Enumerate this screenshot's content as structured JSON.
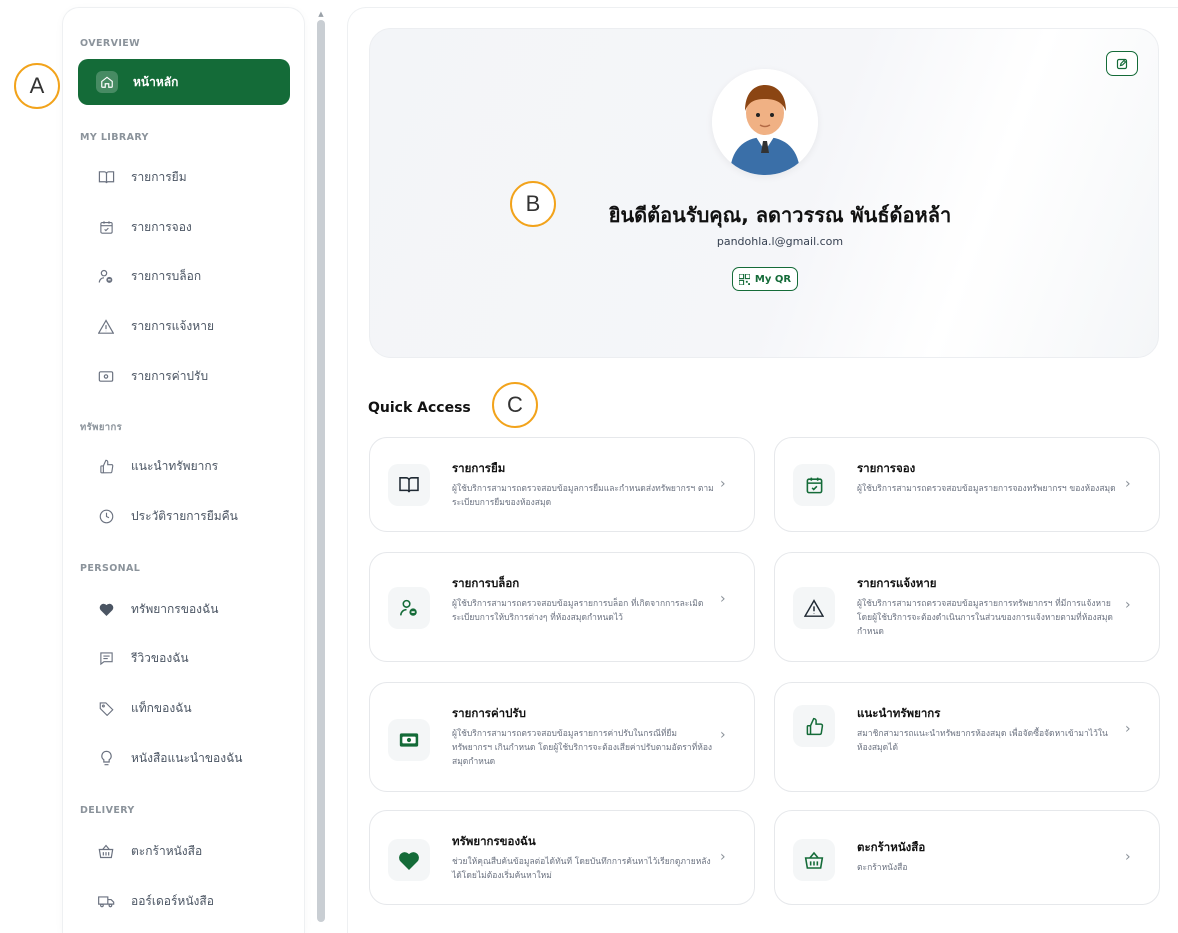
{
  "markers": {
    "a": "A",
    "b": "B",
    "c": "C"
  },
  "sidebar": {
    "sections": [
      {
        "label": "OVERVIEW"
      },
      {
        "label": "MY LIBRARY"
      },
      {
        "label": "ทรัพยากร"
      },
      {
        "label": "PERSONAL"
      },
      {
        "label": "DELIVERY"
      }
    ],
    "items": [
      {
        "label": "หน้าหลัก",
        "icon": "home-icon"
      },
      {
        "label": "รายการยืม",
        "icon": "book-icon"
      },
      {
        "label": "รายการจอง",
        "icon": "calendar-check-icon"
      },
      {
        "label": "รายการบล็อก",
        "icon": "user-block-icon"
      },
      {
        "label": "รายการแจ้งหาย",
        "icon": "warning-icon"
      },
      {
        "label": "รายการค่าปรับ",
        "icon": "money-icon"
      },
      {
        "label": "แนะนำทรัพยากร",
        "icon": "thumbs-up-icon"
      },
      {
        "label": "ประวัติรายการยืมคืน",
        "icon": "clock-icon"
      },
      {
        "label": "ทรัพยากรของฉัน",
        "icon": "heart-icon"
      },
      {
        "label": "รีวิวของฉัน",
        "icon": "comment-icon"
      },
      {
        "label": "แท็กของฉัน",
        "icon": "tag-icon"
      },
      {
        "label": "หนังสือแนะนำของฉัน",
        "icon": "lightbulb-icon"
      },
      {
        "label": "ตะกร้าหนังสือ",
        "icon": "basket-icon"
      },
      {
        "label": "ออร์เดอร์หนังสือ",
        "icon": "truck-icon"
      }
    ]
  },
  "hero": {
    "welcome": "ยินดีต้อนรับคุณ, ลดาวรรณ พันธ์ด้อหล้า",
    "email": "pandohla.l@gmail.com",
    "qr_label": "My QR"
  },
  "quick_access": {
    "title": "Quick Access",
    "cards": [
      {
        "title": "รายการยืม",
        "desc": "ผู้ใช้บริการสามารถตรวจสอบข้อมูลการยืมและกำหนดส่งทรัพยากรฯ ตามระเบียบการยืมของห้องสมุด",
        "icon": "book-icon"
      },
      {
        "title": "รายการจอง",
        "desc": "ผู้ใช้บริการสามารถตรวจสอบข้อมูลรายการจองทรัพยากรฯ ของห้องสมุด",
        "icon": "calendar-check-icon"
      },
      {
        "title": "รายการบล็อก",
        "desc": "ผู้ใช้บริการสามารถตรวจสอบข้อมูลรายการบล็อก ที่เกิดจากการละเมิดระเบียบการให้บริการต่างๆ ที่ห้องสมุดกำหนดไว้",
        "icon": "user-block-icon"
      },
      {
        "title": "รายการแจ้งหาย",
        "desc": "ผู้ใช้บริการสามารถตรวจสอบข้อมูลรายการทรัพยากรฯ ที่มีการแจ้งหาย โดยผู้ใช้บริการจะต้องดำเนินการในส่วนของการแจ้งหายตามที่ห้องสมุดกำหนด",
        "icon": "warning-icon"
      },
      {
        "title": "รายการค่าปรับ",
        "desc": "ผู้ใช้บริการสามารถตรวจสอบข้อมูลรายการค่าปรับในกรณีที่ยืมทรัพยากรฯ เกินกำหนด โดยผู้ใช้บริการจะต้องเสียค่าปรับตามอัตราที่ห้องสมุดกำหนด",
        "icon": "money-icon"
      },
      {
        "title": "แนะนำทรัพยากร",
        "desc": "สมาชิกสามารถแนะนำทรัพยากรห้องสมุด เพื่อจัดซื้อจัดหาเข้ามาไว้ในห้องสมุดได้",
        "icon": "thumbs-up-icon"
      },
      {
        "title": "ทรัพยากรของฉัน",
        "desc": "ช่วยให้คุณสืบค้นข้อมูลต่อได้ทันที โดยบันทึกการค้นหาไว้เรียกดูภายหลังได้โดยไม่ต้องเริ่มค้นหาใหม่",
        "icon": "heart-icon"
      },
      {
        "title": "ตะกร้าหนังสือ",
        "desc": "ตะกร้าหนังสือ",
        "icon": "basket-icon"
      }
    ]
  },
  "colors": {
    "accent": "#146b38",
    "marker": "#f2a31b"
  }
}
